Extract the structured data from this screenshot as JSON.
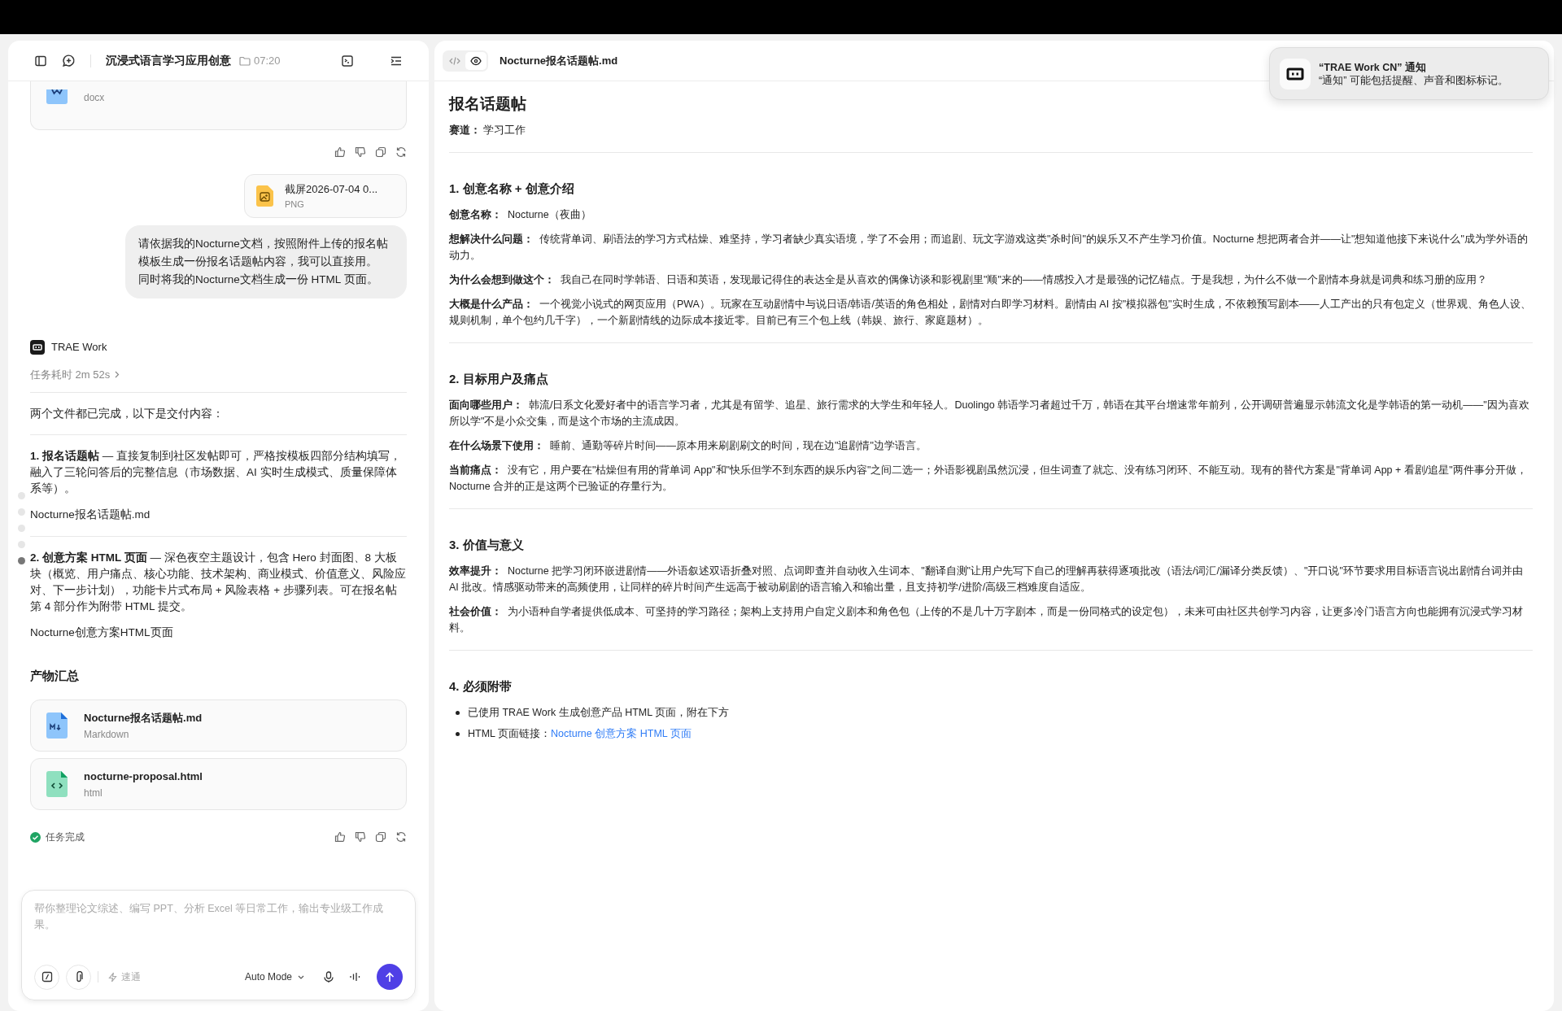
{
  "chat": {
    "title": "沉浸式语言学习应用创意",
    "time": "07:20",
    "partial_attachment": {
      "type": "docx"
    },
    "attachment": {
      "name": "截屏2026-07-04 0...",
      "type": "PNG"
    },
    "user_message": [
      "请依据我的Nocturne文档，按照附件上传的报名帖模板生成一份报名话题帖内容，我可以直接用。",
      "同时将我的Nocturne文档生成一份 HTML 页面。"
    ],
    "agent": "TRAE Work",
    "duration": "任务耗时 2m 52s",
    "intro": "两个文件都已完成，以下是交付内容：",
    "deliverables": [
      {
        "text": "**1. 报名话题帖** — 直接复制到社区发帖即可，严格按模板四部分结构填写，融入了三轮问答后的完整信息（市场数据、AI 实时生成模式、质量保障体系等）。",
        "file": "Nocturne报名话题帖.md"
      },
      {
        "text": "**2. 创意方案 HTML 页面** — 深色夜空主题设计，包含 Hero 封面图、8 大板块（概览、用户痛点、核心功能、技术架构、商业模式、价值意义、风险应对、下一步计划），功能卡片式布局 + 风险表格 + 步骤列表。可在报名帖第 4 部分作为附带 HTML 提交。",
        "file": "Nocturne创意方案HTML页面"
      }
    ],
    "summary_heading": "产物汇总",
    "files": [
      {
        "kind": "markdown",
        "name": "Nocturne报名话题帖.md",
        "type": "Markdown"
      },
      {
        "kind": "html",
        "name": "nocturne-proposal.html",
        "type": "html"
      }
    ],
    "status": "任务完成",
    "timeline_markers": [
      {
        "selected": false
      },
      {
        "selected": false
      },
      {
        "selected": false
      },
      {
        "selected": false
      },
      {
        "selected": true
      }
    ],
    "input": {
      "placeholder": "帮你整理论文综述、编写 PPT、分析 Excel 等日常工作，输出专业级工作成果。",
      "speed": {
        "label": "速通",
        "on": false
      },
      "mode": "Auto Mode"
    }
  },
  "document": {
    "view_toggle": [
      {
        "kind": "code",
        "selected": false
      },
      {
        "kind": "preview",
        "selected": true
      }
    ],
    "filename": "Nocturne报名话题帖.md",
    "title": "报名话题帖",
    "track": "**赛道：**  学习工作",
    "sections": [
      {
        "heading": "1. 创意名称 + 创意介绍",
        "paragraphs": [
          "**创意名称：**  Nocturne（夜曲）",
          "**想解决什么问题：**  传统背单词、刷语法的学习方式枯燥、难坚持，学习者缺少真实语境，学了不会用；而追剧、玩文字游戏这类\"杀时间\"的娱乐又不产生学习价值。Nocturne 想把两者合并——让\"想知道他接下来说什么\"成为学外语的动力。",
          "**为什么会想到做这个：**  我自己在同时学韩语、日语和英语，发现最记得住的表达全是从喜欢的偶像访谈和影视剧里\"顺\"来的——情感投入才是最强的记忆锚点。于是我想，为什么不做一个剧情本身就是词典和练习册的应用？",
          "**大概是什么产品：**  一个视觉小说式的网页应用（PWA）。玩家在互动剧情中与说日语/韩语/英语的角色相处，剧情对白即学习材料。剧情由 AI 按\"模拟器包\"实时生成，不依赖预写剧本——人工产出的只有包定义（世界观、角色人设、规则机制，单个包约几千字），一个新剧情线的边际成本接近零。目前已有三个包上线（韩娱、旅行、家庭题材）。"
        ]
      },
      {
        "heading": "2. 目标用户及痛点",
        "paragraphs": [
          "**面向哪些用户：**  韩流/日系文化爱好者中的语言学习者，尤其是有留学、追星、旅行需求的大学生和年轻人。Duolingo 韩语学习者超过千万，韩语在其平台增速常年前列，公开调研普遍显示韩流文化是学韩语的第一动机——\"因为喜欢所以学\"不是小众交集，而是这个市场的主流成因。",
          "**在什么场景下使用：**  睡前、通勤等碎片时间——原本用来刷剧刷文的时间，现在边\"追剧情\"边学语言。",
          "**当前痛点：**  没有它，用户要在\"枯燥但有用的背单词 App\"和\"快乐但学不到东西的娱乐内容\"之间二选一；外语影视剧虽然沉浸，但生词查了就忘、没有练习闭环、不能互动。现有的替代方案是\"背单词 App + 看剧/追星\"两件事分开做，Nocturne 合并的正是这两个已验证的存量行为。"
        ]
      },
      {
        "heading": "3. 价值与意义",
        "paragraphs": [
          "**效率提升：**  Nocturne 把学习闭环嵌进剧情——外语叙述双语折叠对照、点词即查并自动收入生词本、\"翻译自测\"让用户先写下自己的理解再获得逐项批改（语法/词汇/漏译分类反馈）、\"开口说\"环节要求用目标语言说出剧情台词并由 AI 批改。情感驱动带来的高频使用，让同样的碎片时间产生远高于被动刷剧的语言输入和输出量，且支持初学/进阶/高级三档难度自适应。",
          "**社会价值：**  为小语种自学者提供低成本、可坚持的学习路径；架构上支持用户自定义剧本和角色包（上传的不是几十万字剧本，而是一份同格式的设定包），未来可由社区共创学习内容，让更多冷门语言方向也能拥有沉浸式学习材料。"
        ]
      },
      {
        "heading": "4. 必须附带",
        "bullets": [
          {
            "text": "已使用 TRAE Work 生成创意产品 HTML 页面，附在下方"
          },
          {
            "text": "HTML 页面链接：",
            "link": "Nocturne 创意方案 HTML 页面"
          }
        ]
      }
    ]
  },
  "notification": {
    "title": "“TRAE Work CN” 通知",
    "body": "“通知” 可能包括提醒、声音和图标标记。"
  }
}
